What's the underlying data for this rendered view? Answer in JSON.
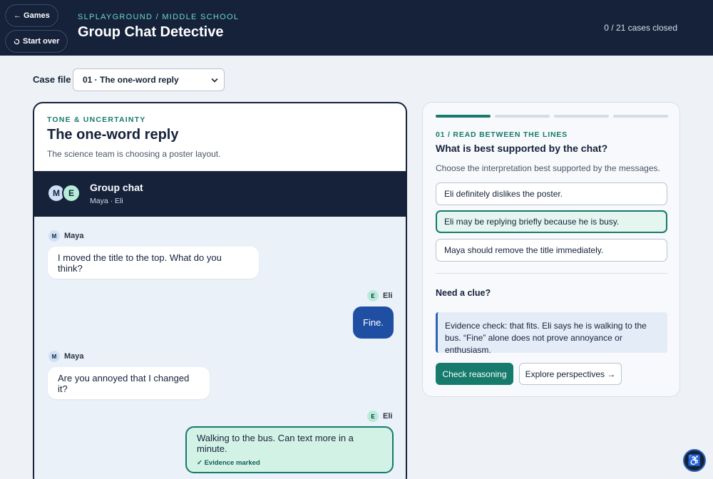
{
  "header": {
    "games_button": "← Games",
    "restart_button": "Start over",
    "eyebrow": "SLPLAYGROUND / MIDDLE SCHOOL",
    "title": "Group Chat Detective",
    "progress_text": "0 / 21 cases closed"
  },
  "case_select": {
    "label": "Case file",
    "value": "01 · The one-word reply"
  },
  "scenario": {
    "eyebrow": "TONE & UNCERTAINTY",
    "title": "The one-word reply",
    "subtitle": "The science team is choosing a poster layout."
  },
  "chat": {
    "title": "Group chat",
    "members": "Maya · Eli",
    "avatars": [
      "M",
      "E"
    ],
    "messages": [
      {
        "sender": "Maya",
        "initial": "M",
        "text": "I moved the title to the top. What do you think?"
      },
      {
        "sender": "Eli",
        "initial": "E",
        "text": "Fine."
      },
      {
        "sender": "Maya",
        "initial": "M",
        "text": "Are you annoyed that I changed it?"
      },
      {
        "sender": "Eli",
        "initial": "E",
        "text": "Walking to the bus. Can text more in a minute.",
        "tag": "✓ Evidence marked"
      }
    ]
  },
  "question": {
    "progress_segments": [
      true,
      false,
      false,
      false
    ],
    "eyebrow": "01 / READ BETWEEN THE LINES",
    "title": "What is best supported by the chat?",
    "instructions": "Choose the interpretation best supported by the messages.",
    "options": [
      "Eli definitely dislikes the poster.",
      "Eli may be replying briefly because he is busy.",
      "Maya should remove the title immediately."
    ],
    "selected_index": 1,
    "clue_label": "Need a clue?",
    "clue_text": "Evidence check: that fits. Eli says he is walking to the bus. “Fine” alone does not prove annoyance or enthusiasm.",
    "check_button": "Check reasoning",
    "explore_button": "Explore perspectives →"
  },
  "accessibility_icon": "♿",
  "colors": {
    "navy": "#15223a",
    "teal": "#167a6c",
    "blue_bubble": "#1f4fa3",
    "evidence_bg": "#d3f2e6"
  }
}
